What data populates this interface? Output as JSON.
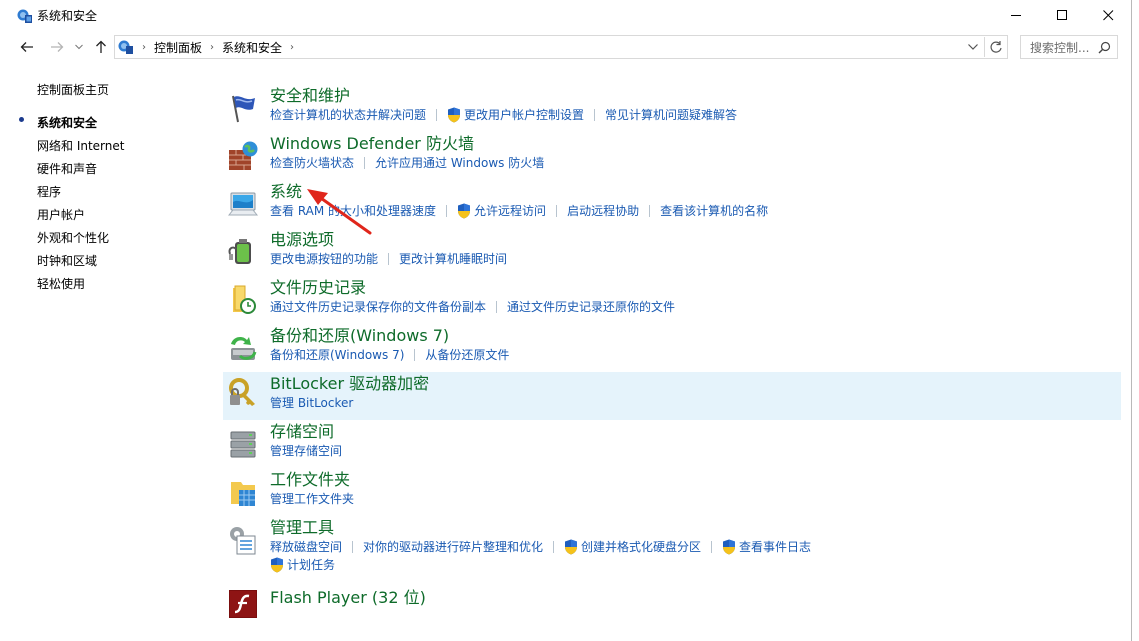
{
  "window": {
    "title": "系统和安全"
  },
  "address": {
    "crumbs": [
      "控制面板",
      "系统和安全"
    ],
    "search_placeholder": "搜索控制..."
  },
  "sidebar": {
    "items": [
      {
        "label": "控制面板主页"
      },
      {
        "label": "系统和安全"
      },
      {
        "label": "网络和 Internet"
      },
      {
        "label": "硬件和声音"
      },
      {
        "label": "程序"
      },
      {
        "label": "用户帐户"
      },
      {
        "label": "外观和个性化"
      },
      {
        "label": "时钟和区域"
      },
      {
        "label": "轻松使用"
      }
    ]
  },
  "categories": [
    {
      "title": "安全和维护",
      "icon": "flag-icon",
      "links": [
        {
          "label": "检查计算机的状态并解决问题"
        },
        {
          "label": "更改用户帐户控制设置",
          "shield": true
        },
        {
          "label": "常见计算机问题疑难解答"
        }
      ]
    },
    {
      "title": "Windows Defender 防火墙",
      "icon": "firewall-icon",
      "links": [
        {
          "label": "检查防火墙状态"
        },
        {
          "label": "允许应用通过 Windows 防火墙"
        }
      ]
    },
    {
      "title": "系统",
      "icon": "computer-icon",
      "links": [
        {
          "label": "查看 RAM 的大小和处理器速度"
        },
        {
          "label": "允许远程访问",
          "shield": true
        },
        {
          "label": "启动远程协助"
        },
        {
          "label": "查看该计算机的名称"
        }
      ]
    },
    {
      "title": "电源选项",
      "icon": "battery-icon",
      "links": [
        {
          "label": "更改电源按钮的功能"
        },
        {
          "label": "更改计算机睡眠时间"
        }
      ]
    },
    {
      "title": "文件历史记录",
      "icon": "file-history-icon",
      "links": [
        {
          "label": "通过文件历史记录保存你的文件备份副本"
        },
        {
          "label": "通过文件历史记录还原你的文件"
        }
      ]
    },
    {
      "title": "备份和还原(Windows 7)",
      "icon": "backup-icon",
      "links": [
        {
          "label": "备份和还原(Windows 7)"
        },
        {
          "label": "从备份还原文件"
        }
      ]
    },
    {
      "title": "BitLocker 驱动器加密",
      "icon": "bitlocker-key-icon",
      "links": [
        {
          "label": "管理 BitLocker"
        }
      ]
    },
    {
      "title": "存储空间",
      "icon": "storage-drives-icon",
      "links": [
        {
          "label": "管理存储空间"
        }
      ]
    },
    {
      "title": "工作文件夹",
      "icon": "work-folders-icon",
      "links": [
        {
          "label": "管理工作文件夹"
        }
      ]
    },
    {
      "title": "管理工具",
      "icon": "admin-tools-icon",
      "links": [
        {
          "label": "释放磁盘空间"
        },
        {
          "label": "对你的驱动器进行碎片整理和优化"
        },
        {
          "label": "创建并格式化硬盘分区",
          "shield": true
        },
        {
          "label": "查看事件日志",
          "shield": true
        }
      ],
      "links2": [
        {
          "label": "计划任务",
          "shield": true
        }
      ]
    },
    {
      "title": "Flash Player (32 位)",
      "icon": "flash-player-icon",
      "links": []
    }
  ],
  "colors": {
    "title_green": "#0e6b2a",
    "link_blue": "#1a5ab2",
    "highlight": "#e5f3fb",
    "annotation_arrow": "#e0261b"
  }
}
